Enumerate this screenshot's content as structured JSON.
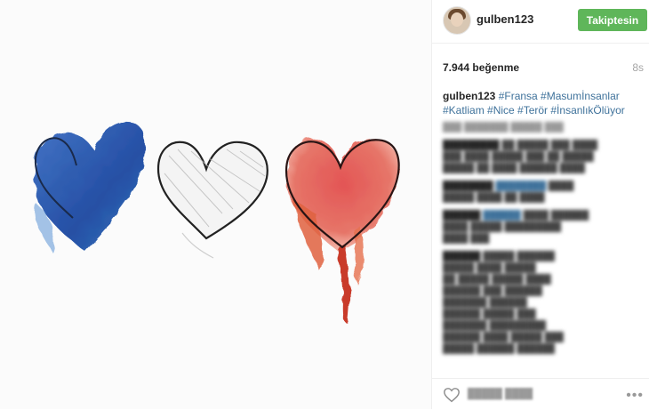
{
  "post": {
    "username": "gulben123",
    "follow_label": "Takiptesin",
    "likes": "7.944 beğenme",
    "time": "8s",
    "caption_user": "gulben123",
    "caption_tags_line1": "#Fransa #Masumİnsanlar",
    "caption_tags_line2": "#Katliam #Nice #Terör #İnsanlıkÖlüyor"
  },
  "colors": {
    "follow_bg": "#5fb65a",
    "hashtag": "#3f729b",
    "heart_blue": "#1f4fa8",
    "heart_red": "#d83a3a"
  },
  "icons": {
    "like": "heart-outline-icon",
    "more": "ellipsis-icon"
  }
}
